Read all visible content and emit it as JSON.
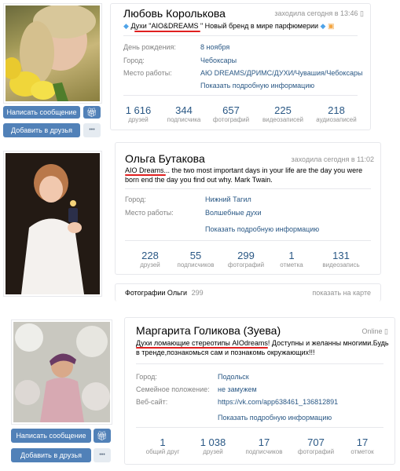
{
  "profiles": [
    {
      "name": "Любовь Королькова",
      "online": "заходила сегодня в 13:46",
      "status": "Духи \"AIO&DREAMS \" Новый бренд в мире парфюмерии",
      "info": [
        {
          "label": "День рождения:",
          "value": "8 ноября"
        },
        {
          "label": "Город:",
          "value": "Чебоксары"
        },
        {
          "label": "Место работы:",
          "value": "АЮ DREAMS/ДРИМС/ДУХИ/Чувашия/Чебоксары"
        }
      ],
      "more": "Показать подробную информацию",
      "counters": [
        {
          "n": "1 616",
          "t": "друзей"
        },
        {
          "n": "344",
          "t": "подписчика"
        },
        {
          "n": "657",
          "t": "фотографий"
        },
        {
          "n": "225",
          "t": "видеозаписей"
        },
        {
          "n": "218",
          "t": "аудиозаписей"
        }
      ],
      "buttons": {
        "message": "Написать сообщение",
        "add": "Добавить в друзья",
        "more_dots": "•••"
      }
    },
    {
      "name": "Ольга Бутакова",
      "online": "заходила сегодня в 11:02",
      "status": "AIO Dreams... the two most important days in your life are the day you were born end the day you find out why. Mark Twain.",
      "info": [
        {
          "label": "Город:",
          "value": "Нижний Тагил"
        },
        {
          "label": "Место работы:",
          "value": "Волшебные духи"
        }
      ],
      "more": "Показать подробную информацию",
      "counters": [
        {
          "n": "228",
          "t": "друзей"
        },
        {
          "n": "55",
          "t": "подписчиков"
        },
        {
          "n": "299",
          "t": "фотографий"
        },
        {
          "n": "1",
          "t": "отметка"
        },
        {
          "n": "131",
          "t": "видеозапись"
        }
      ],
      "photos_label": "Фотографии Ольги",
      "photos_count": "299",
      "map_link": "показать на карте"
    },
    {
      "name": "Маргарита Голикова (Зуева)",
      "online": "Online",
      "status": "Духи ломающие стереотипы AIOdreams! Доступны и желанны многими.Будь в тренде,познакомься сам и познакомь окружающих!!!",
      "info": [
        {
          "label": "Город:",
          "value": "Подольск"
        },
        {
          "label": "Семейное положение:",
          "value": "не замужем"
        },
        {
          "label": "Веб-сайт:",
          "value": "https://vk.com/app638461_136812891"
        }
      ],
      "more": "Показать подробную информацию",
      "counters": [
        {
          "n": "1",
          "t": "общий друг"
        },
        {
          "n": "1 038",
          "t": "друзей"
        },
        {
          "n": "17",
          "t": "подписчиков"
        },
        {
          "n": "707",
          "t": "фотографий"
        },
        {
          "n": "17",
          "t": "отметок"
        }
      ],
      "buttons": {
        "message": "Написать сообщение",
        "add": "Добавить в друзья",
        "more_dots": "•••"
      }
    }
  ],
  "colors": {
    "link": "#2a5885",
    "button": "#5181b8",
    "underline": "#e02020"
  }
}
